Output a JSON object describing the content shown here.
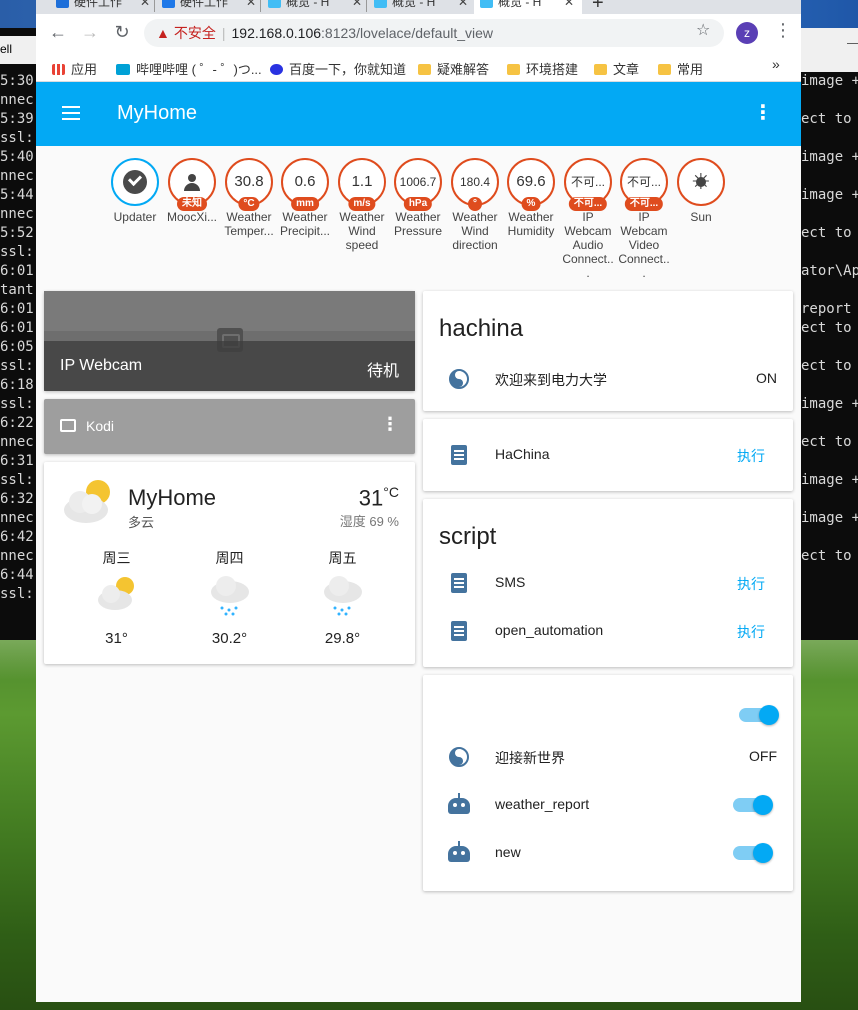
{
  "desktop": {
    "terminal_left_head": "ell",
    "terminal_left_lines": [
      "5:30",
      "nnec",
      "5:39",
      "ssl:",
      "5:40",
      "nnec",
      "5:44",
      "nnec",
      "5:52",
      "ssl:",
      "6:01",
      "tant",
      "6:01",
      "6:01",
      "6:05",
      "ssl:",
      "6:18",
      "ssl:",
      "6:22",
      "nnec",
      "6:31",
      "ssl:",
      "6:32",
      "nnec",
      "6:42",
      "nnec",
      "6:44",
      "ssl:"
    ],
    "terminal_right_head": "—",
    "terminal_right_lines": [
      "image +",
      "",
      "ect to",
      "",
      "image +",
      "",
      "image +",
      "",
      "ect to",
      "",
      "ator\\Ap",
      "",
      "report",
      "ect to",
      "",
      "ect to",
      "",
      "image +",
      "",
      "ect to",
      "",
      "image +",
      "",
      "image +",
      "",
      "ect to"
    ]
  },
  "browser": {
    "tabs": [
      {
        "title": "硬件工作",
        "icon_color": "#1e6fd9"
      },
      {
        "title": "硬件工作",
        "icon_color": "#1e78e8"
      },
      {
        "title": "概览 - H",
        "icon_color": "#41bdf5"
      },
      {
        "title": "概览 - H",
        "icon_color": "#41bdf5"
      },
      {
        "title": "概览 - H",
        "icon_color": "#41bdf5"
      }
    ],
    "tab_icon_labels": [
      "B",
      "知",
      "",
      "",
      ""
    ],
    "newtab": "+",
    "omnibox": {
      "warning": "不安全",
      "host": "192.168.0.106",
      "path": ":8123/lovelace/default_view"
    },
    "profile_initial": "z",
    "bookmarks": [
      {
        "label": "应用",
        "icon": "apps-grid-icon",
        "color": "#e94235"
      },
      {
        "label": "哔哩哔哩 ( ゜- ゜)つ...",
        "icon": "bilibili-icon",
        "color": "#00a1d6"
      },
      {
        "label": "百度一下，你就知道",
        "icon": "baidu-paw-icon",
        "color": "#2932e1"
      },
      {
        "label": "疑难解答",
        "icon": "folder-icon",
        "color": "#f6c343"
      },
      {
        "label": "环境搭建",
        "icon": "folder-icon",
        "color": "#f6c343"
      },
      {
        "label": "文章",
        "icon": "folder-icon",
        "color": "#f6c343"
      },
      {
        "label": "常用",
        "icon": "folder-icon",
        "color": "#f6c343"
      }
    ],
    "bookmarks_more": "»"
  },
  "app": {
    "title": "MyHome",
    "accent": "#03a9f4",
    "badge_color": "#df4c1e"
  },
  "badges": [
    {
      "value": "",
      "unit": "",
      "label": "Updater",
      "icon": "check-circle-icon"
    },
    {
      "value": "",
      "unit": "未知",
      "label": "MoocXi...",
      "icon": "person-icon"
    },
    {
      "value": "30.8",
      "unit": "°C",
      "label": "Weather Temper..."
    },
    {
      "value": "0.6",
      "unit": "mm",
      "label": "Weather Precipit..."
    },
    {
      "value": "1.1",
      "unit": "m/s",
      "label": "Weather Wind speed"
    },
    {
      "value": "1006.7",
      "unit": "hPa",
      "label": "Weather Pressure"
    },
    {
      "value": "180.4",
      "unit": "°",
      "label": "Weather Wind direction"
    },
    {
      "value": "69.6",
      "unit": "%",
      "label": "Weather Humidity"
    },
    {
      "value": "不可...",
      "unit": "不可...",
      "label": "IP Webcam Audio Connect..."
    },
    {
      "value": "不可...",
      "unit": "不可...",
      "label": "IP Webcam Video Connect..."
    },
    {
      "value": "",
      "unit": "",
      "label": "Sun",
      "icon": "sun-icon"
    }
  ],
  "webcam": {
    "name": "IP Webcam",
    "state": "待机"
  },
  "kodi": {
    "name": "Kodi"
  },
  "weather": {
    "name": "MyHome",
    "condition": "多云",
    "temperature": "31",
    "unit": "°C",
    "humidity": "湿度 69 %",
    "forecast": [
      {
        "day": "周三",
        "temp": "31°",
        "icon": "partly-cloudy-icon"
      },
      {
        "day": "周四",
        "temp": "30.2°",
        "icon": "rainy-icon"
      },
      {
        "day": "周五",
        "temp": "29.8°",
        "icon": "rainy-icon"
      }
    ]
  },
  "hachina_card": {
    "title": "hachina",
    "rows": [
      {
        "name": "欢迎来到电力大学",
        "state": "ON"
      }
    ]
  },
  "hachina_script_card": {
    "rows": [
      {
        "name": "HaChina",
        "action": "执行"
      }
    ]
  },
  "script_card": {
    "title": "script",
    "rows": [
      {
        "name": "SMS",
        "action": "执行"
      },
      {
        "name": "open_automation",
        "action": "执行"
      }
    ]
  },
  "automation_card": {
    "header_toggle": true,
    "rows": [
      {
        "name": "迎接新世界",
        "state": "OFF"
      },
      {
        "name": "weather_report",
        "toggle": true
      },
      {
        "name": "new",
        "toggle": true
      }
    ]
  }
}
